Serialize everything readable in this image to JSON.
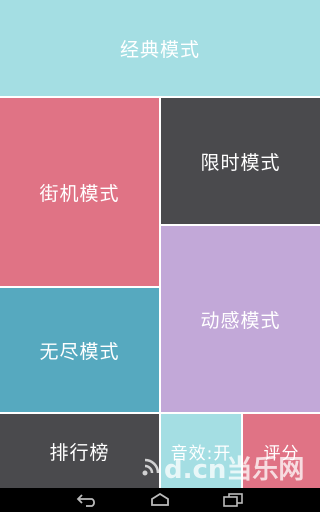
{
  "colors": {
    "classic": "#a4dee3",
    "arcade": "#e07385",
    "timed": "#4a4a4d",
    "dynamic": "#c2a8d8",
    "endless": "#56a9bf",
    "rank": "#4a4a4d",
    "sound": "#a4dee3",
    "rate": "#e07385",
    "navbar": "#000000"
  },
  "menu": {
    "classic_label": "经典模式",
    "arcade_label": "街机模式",
    "timed_label": "限时模式",
    "dynamic_label": "动感模式",
    "endless_label": "无尽模式",
    "rank_label": "排行榜",
    "sound_label": "音效:开",
    "rate_label": "评分"
  },
  "watermark": {
    "text": "d.cn当乐网"
  },
  "navbar": {
    "icons": [
      "back-icon",
      "home-icon",
      "recent-apps-icon"
    ]
  }
}
